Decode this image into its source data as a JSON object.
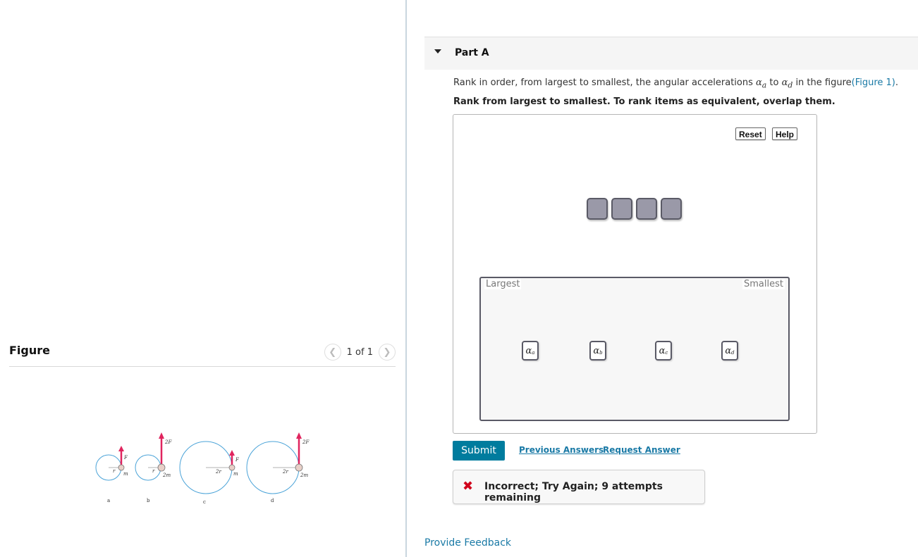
{
  "figure": {
    "title": "Figure",
    "pager_text": "1 of 1",
    "prev_icon": "chevron-left-icon",
    "next_icon": "chevron-right-icon",
    "diagrams": [
      {
        "label": "a",
        "radius_label": "r",
        "mass_label": "m",
        "force_label": "F"
      },
      {
        "label": "b",
        "radius_label": "r",
        "mass_label": "2m",
        "force_label": "2F"
      },
      {
        "label": "c",
        "radius_label": "2r",
        "mass_label": "m",
        "force_label": "F"
      },
      {
        "label": "d",
        "radius_label": "2r",
        "mass_label": "2m",
        "force_label": "2F"
      }
    ],
    "colors": {
      "circle": "#4aa3d8",
      "arrow": "#e0245e"
    }
  },
  "part": {
    "title": "Part A",
    "prompt_pre": "Rank in order, from largest to smallest, the angular accelerations ",
    "alpha_a": "α",
    "sub_a": "a",
    "prompt_mid": " to ",
    "alpha_d": "α",
    "sub_d": "d",
    "prompt_post": " in the figure",
    "figure_link": "(Figure 1)",
    "prompt_end": ".",
    "instruction": "Rank from largest to smallest. To rank items as equivalent, overlap them."
  },
  "ranking": {
    "reset_label": "Reset",
    "help_label": "Help",
    "largest_label": "Largest",
    "smallest_label": "Smallest",
    "empty_slots": 4,
    "tokens": [
      {
        "symbol": "α",
        "sub": "a"
      },
      {
        "symbol": "α",
        "sub": "b"
      },
      {
        "symbol": "α",
        "sub": "c"
      },
      {
        "symbol": "α",
        "sub": "d"
      }
    ]
  },
  "actions": {
    "submit_label": "Submit",
    "previous_answers": "Previous Answers",
    "request_answer": "Request Answer"
  },
  "feedback": {
    "icon": "x-icon",
    "message": "Incorrect; Try Again; 9 attempts remaining",
    "color": "#d0021b"
  },
  "footer": {
    "provide_feedback": "Provide Feedback"
  }
}
